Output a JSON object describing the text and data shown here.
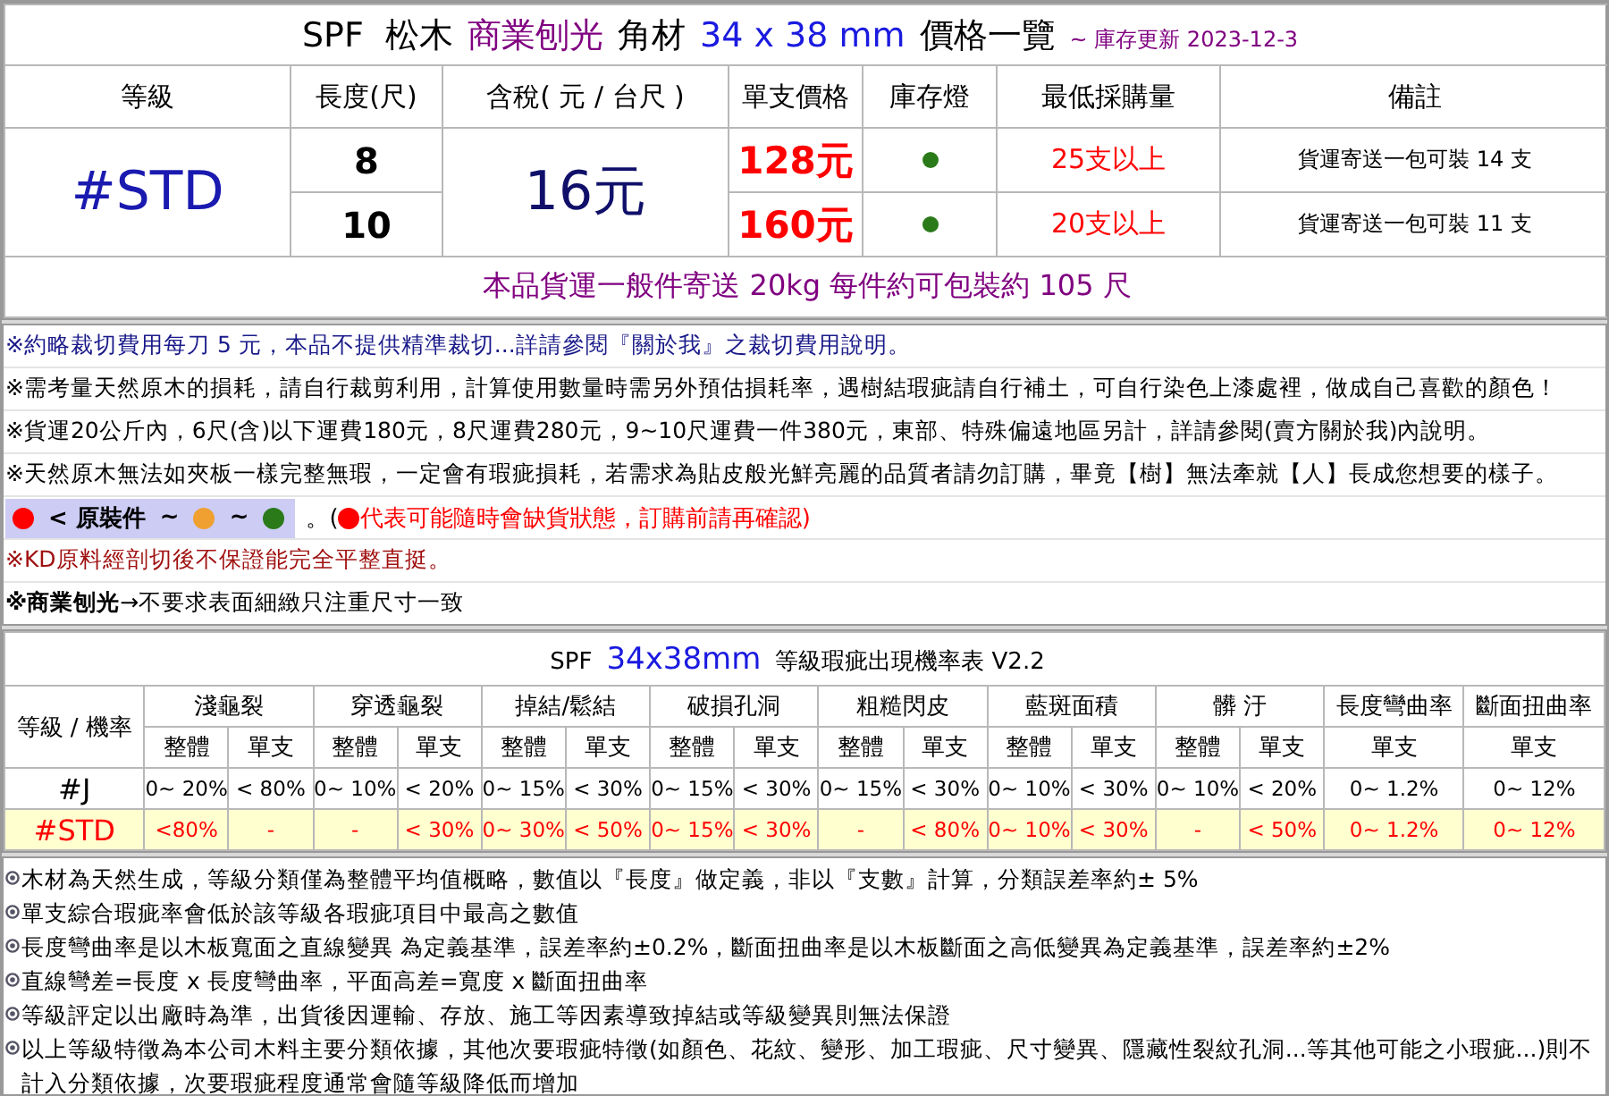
{
  "title": {
    "segments": [
      {
        "kind": "plain",
        "text": "SPF  松木"
      },
      {
        "kind": "accent",
        "text": "商業刨光"
      },
      {
        "kind": "plain",
        "text": "角材"
      },
      {
        "kind": "size",
        "text": "34 x 38 mm"
      },
      {
        "kind": "plain",
        "text": "價格一覽"
      },
      {
        "kind": "date",
        "text": "~ 庫存更新 2023-12-3"
      }
    ]
  },
  "price_table": {
    "columns": [
      "等級",
      "長度(尺)",
      "含稅( 元 / 台尺 )",
      "單支價格",
      "庫存燈",
      "最低採購量",
      "備註"
    ],
    "grade": "#STD",
    "price_per_unit": "16元",
    "rows": [
      {
        "length": "8",
        "unit_price": "128元",
        "color": "#2a7a1a",
        "min_order": "25支以上",
        "note": "貨運寄送一包可裝 14 支"
      },
      {
        "length": "10",
        "unit_price": "160元",
        "color": "#2a7a1a",
        "min_order": "20支以上",
        "note": "貨運寄送一包可裝 11 支"
      }
    ],
    "shipping_banner": "本品貨運一般件寄送 20kg 每件約可包裝約 105 尺"
  },
  "notes": [
    {
      "kind": "text",
      "color": "#1a1a8a",
      "text": "※約略裁切費用每刀 5 元，本品不提供精準裁切...詳請參閱『關於我』之裁切費用說明。"
    },
    {
      "kind": "text",
      "color": "#000000",
      "text": "※需考量天然原木的損耗，請自行裁剪利用，計算使用數量時需另外預估損耗率，遇樹結瑕疵請自行補土，可自行染色上漆處裡，做成自己喜歡的顏色！"
    },
    {
      "kind": "text",
      "color": "#000000",
      "text": "※貨運20公斤內，6尺(含)以下運費180元，8尺運費280元，9~10尺運費一件380元，東部、特殊偏遠地區另計，詳請參閱(賣方關於我)內說明。"
    },
    {
      "kind": "text",
      "color": "#000000",
      "text": "※天然原木無法如夾板一樣完整無瑕，一定會有瑕疵損耗，若需求為貼皮般光鮮亮麗的品質者請勿訂購，畢竟【樹】無法牽就【人】長成您想要的樣子。"
    },
    {
      "kind": "legend",
      "badge": [
        {
          "kind": "dot",
          "color": "#ff0000"
        },
        {
          "kind": "text",
          "text": "< 原裝件"
        },
        {
          "kind": "text",
          "text": "~"
        },
        {
          "kind": "dot",
          "color": "#f0a030"
        },
        {
          "kind": "text",
          "text": "~"
        },
        {
          "kind": "dot",
          "color": "#2a7a1a"
        }
      ],
      "suffix": [
        {
          "kind": "text",
          "text": "。("
        },
        {
          "kind": "dot",
          "color": "#ff0000"
        },
        {
          "kind": "warn",
          "text": "代表可能隨時會缺貨狀態，訂購前請再確認)"
        }
      ]
    },
    {
      "kind": "text",
      "color": "#a01010",
      "text": "※KD原料經剖切後不保證能完全平整直挺。"
    },
    {
      "kind": "text",
      "color": "#000000",
      "text": "**※商業刨光**→不要求表面細緻只注重尺寸一致"
    }
  ],
  "defect_table": {
    "title": {
      "segments": [
        {
          "kind": "plain",
          "text": "SPF"
        },
        {
          "kind": "size",
          "text": "34x38mm"
        },
        {
          "kind": "plain",
          "text": "等級瑕疵出現機率表 V2.2"
        }
      ]
    },
    "corner": "等級 / 機率",
    "groups": [
      {
        "name": "淺龜裂",
        "subs": [
          "整體",
          "單支"
        ]
      },
      {
        "name": "穿透龜裂",
        "subs": [
          "整體",
          "單支"
        ]
      },
      {
        "name": "掉結/鬆結",
        "subs": [
          "整體",
          "單支"
        ]
      },
      {
        "name": "破損孔洞",
        "subs": [
          "整體",
          "單支"
        ]
      },
      {
        "name": "粗糙閃皮",
        "subs": [
          "整體",
          "單支"
        ]
      },
      {
        "name": "藍斑面積",
        "subs": [
          "整體",
          "單支"
        ]
      },
      {
        "name": "髒 汙",
        "subs": [
          "整體",
          "單支"
        ]
      },
      {
        "name": "長度彎曲率",
        "subs": [
          "單支"
        ]
      },
      {
        "name": "斷面扭曲率",
        "subs": [
          "單支"
        ]
      }
    ],
    "rows": [
      {
        "grade": "#J",
        "highlighted": false,
        "cells": [
          "0~ 20%",
          "< 80%",
          "0~ 10%",
          "< 20%",
          "0~ 15%",
          "< 30%",
          "0~ 15%",
          "< 30%",
          "0~ 15%",
          "< 30%",
          "0~ 10%",
          "< 30%",
          "0~ 10%",
          "< 20%",
          "0~ 1.2%",
          "0~ 12%"
        ]
      },
      {
        "grade": "#STD",
        "highlighted": true,
        "cells": [
          "<80%",
          "-",
          "-",
          "< 30%",
          "0~ 30%",
          "< 50%",
          "0~ 15%",
          "< 30%",
          "-",
          "< 80%",
          "0~ 10%",
          "< 30%",
          "-",
          "< 50%",
          "0~ 1.2%",
          "0~ 12%"
        ]
      }
    ]
  },
  "bullets": [
    "木材為天然生成，等級分類僅為整體平均值概略，數值以『長度』做定義，非以『支數』計算，分類誤差率約± 5%",
    "單支綜合瑕疵率會低於該等級各瑕疵項目中最高之數值",
    "長度彎曲率是以木板寬面之直線變異 為定義基準，誤差率約±0.2%，斷面扭曲率是以木板斷面之高低變異為定義基準，誤差率約±2%",
    "直線彎差=長度 x 長度彎曲率，平面高差=寬度 x 斷面扭曲率",
    "等級評定以出廠時為準，出貨後因運輸、存放、施工等因素導致掉結或等級變異則無法保證",
    "以上等級特徵為本公司木料主要分類依據，其他次要瑕疵特徵(如顏色、花紋、變形、加工瑕疵、尺寸變異、隱藏性裂紋孔洞...等其他可能之小瑕疵...)則不計入分類依據，次要瑕疵程度通常會隨等級降低而增加"
  ]
}
